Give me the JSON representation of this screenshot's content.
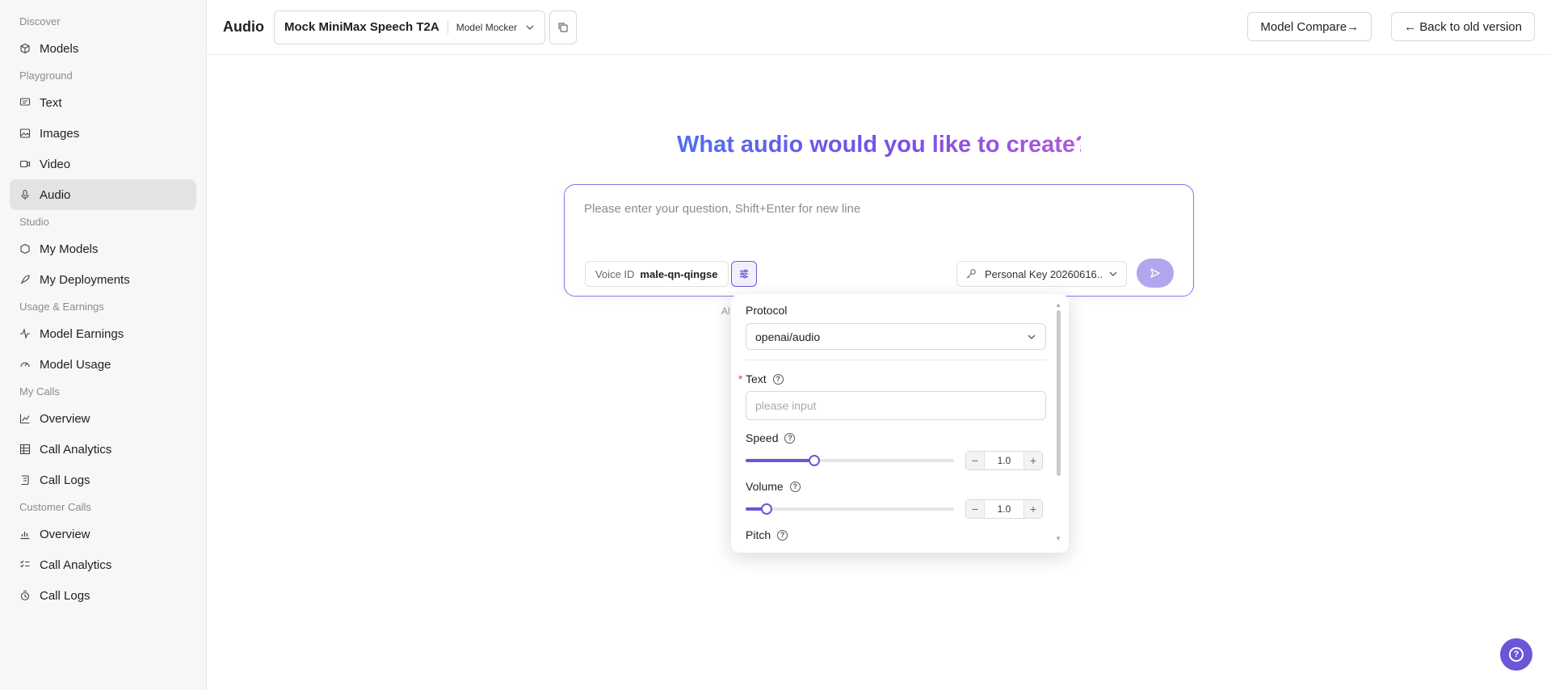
{
  "sidebar": {
    "sections": [
      {
        "title": "Discover",
        "items": [
          {
            "label": "Models",
            "icon": "cube-icon"
          }
        ]
      },
      {
        "title": "Playground",
        "items": [
          {
            "label": "Text",
            "icon": "chat-icon"
          },
          {
            "label": "Images",
            "icon": "image-icon"
          },
          {
            "label": "Video",
            "icon": "video-icon"
          },
          {
            "label": "Audio",
            "icon": "mic-icon",
            "active": true
          }
        ]
      },
      {
        "title": "Studio",
        "items": [
          {
            "label": "My Models",
            "icon": "box-icon"
          },
          {
            "label": "My Deployments",
            "icon": "rocket-icon"
          }
        ]
      },
      {
        "title": "Usage & Earnings",
        "items": [
          {
            "label": "Model Earnings",
            "icon": "pulse-icon"
          },
          {
            "label": "Model Usage",
            "icon": "gauge-icon"
          }
        ]
      },
      {
        "title": "My Calls",
        "items": [
          {
            "label": "Overview",
            "icon": "line-chart-icon"
          },
          {
            "label": "Call Analytics",
            "icon": "table-icon"
          },
          {
            "label": "Call Logs",
            "icon": "scroll-icon"
          }
        ]
      },
      {
        "title": "Customer Calls",
        "items": [
          {
            "label": "Overview",
            "icon": "bar-chart-icon"
          },
          {
            "label": "Call Analytics",
            "icon": "list-check-icon"
          },
          {
            "label": "Call Logs",
            "icon": "logs-icon"
          }
        ]
      }
    ]
  },
  "header": {
    "title": "Audio",
    "model_name": "Mock MiniMax Speech T2A",
    "model_owner": "Model Mocker",
    "compare_label": "Model Compare→",
    "back_label": "← Back to old version"
  },
  "main": {
    "hero": "What audio would you like to create?",
    "prompt_placeholder": "Please enter your question, Shift+Enter for new line",
    "voice_label": "Voice ID",
    "voice_value": "male-qn-qingse",
    "key_value": "Personal Key 20260616...",
    "hint_fragment": "Al"
  },
  "panel": {
    "protocol_label": "Protocol",
    "protocol_value": "openai/audio",
    "text_label": "Text",
    "text_placeholder": "please input",
    "speed_label": "Speed",
    "speed_value": "1.0",
    "speed_fraction": 0.33,
    "volume_label": "Volume",
    "volume_value": "1.0",
    "volume_fraction": 0.1,
    "pitch_label": "Pitch"
  },
  "colors": {
    "accent": "#6c55d6",
    "gradient_start": "#4f6ef2",
    "gradient_end": "#b05ad9"
  }
}
